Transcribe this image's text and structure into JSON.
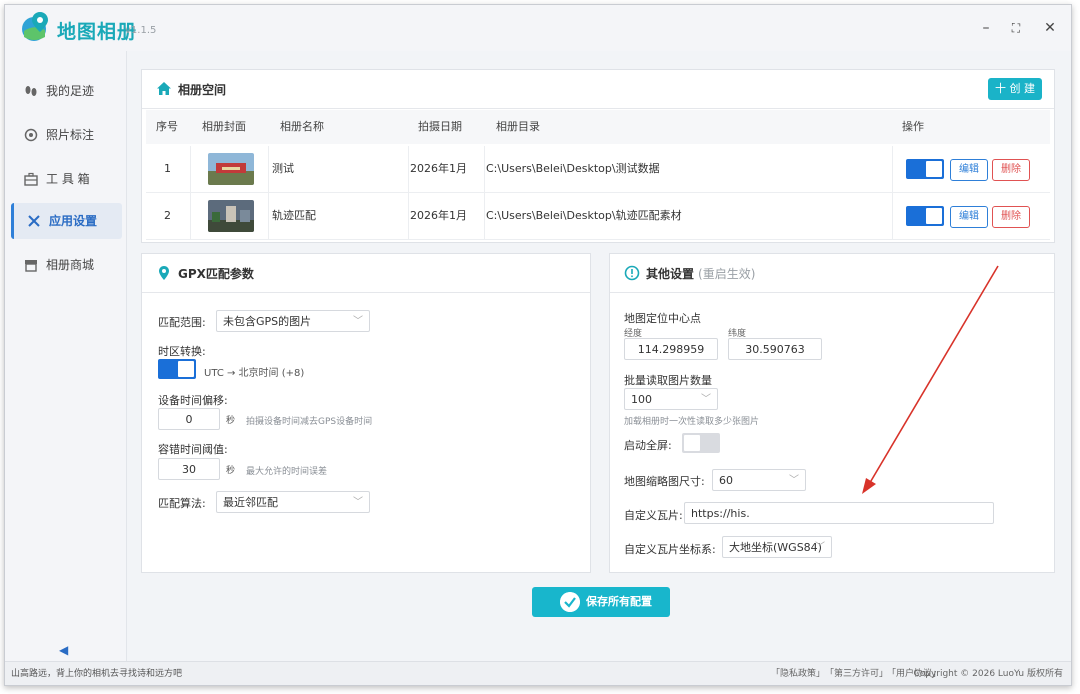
{
  "app": {
    "title": "地图相册",
    "version": "v1.1.5"
  },
  "window_controls": {
    "minimize": "–",
    "maximize": "⛶",
    "close": "✕"
  },
  "sidebar": {
    "items": [
      {
        "label": "我的足迹",
        "icon": "footprint-icon"
      },
      {
        "label": "照片标注",
        "icon": "target-icon"
      },
      {
        "label": "工 具 箱",
        "icon": "toolbox-icon"
      },
      {
        "label": "应用设置",
        "icon": "tools-icon",
        "active": true
      },
      {
        "label": "相册商城",
        "icon": "shop-icon"
      }
    ],
    "collapse": "◀"
  },
  "album_space": {
    "title": "相册空间",
    "create_label": "十 创 建",
    "columns": [
      "序号",
      "相册封面",
      "相册名称",
      "拍摄日期",
      "相册目录",
      "操作"
    ],
    "rows": [
      {
        "index": "1",
        "name": "测试",
        "date": "2026年1月",
        "path": "C:\\Users\\Belei\\Desktop\\测试数据",
        "enabled": true,
        "edit": "编辑",
        "delete": "删除"
      },
      {
        "index": "2",
        "name": "轨迹匹配",
        "date": "2026年1月",
        "path": "C:\\Users\\Belei\\Desktop\\轨迹匹配素材",
        "enabled": true,
        "edit": "编辑",
        "delete": "删除"
      }
    ]
  },
  "gpx": {
    "title": "GPX匹配参数",
    "range_label": "匹配范围:",
    "range_value": "未包含GPS的图片",
    "tz_label": "时区转换:",
    "tz_text": "UTC → 北京时间 (+8)",
    "tz_enabled": true,
    "offset_label": "设备时间偏移:",
    "offset_value": "0",
    "offset_unit": "秒",
    "offset_hint": "拍摄设备时间减去GPS设备时间",
    "tolerance_label": "容错时间阈值:",
    "tolerance_value": "30",
    "tolerance_unit": "秒",
    "tolerance_hint": "最大允许的时间误差",
    "algo_label": "匹配算法:",
    "algo_value": "最近邻匹配"
  },
  "other": {
    "title": "其他设置",
    "subtitle": "(重启生效)",
    "center_label": "地图定位中心点",
    "lng_label": "经度",
    "lng_value": "114.298959",
    "lat_label": "纬度",
    "lat_value": "30.590763",
    "batch_label": "批量读取图片数量",
    "batch_value": "100",
    "batch_hint": "加载相册时一次性读取多少张图片",
    "fullscreen_label": "启动全屏:",
    "fullscreen_enabled": false,
    "thumb_label": "地图缩略图尺寸:",
    "thumb_value": "60",
    "tile_label": "自定义瓦片:",
    "tile_value": "https://his.",
    "crs_label": "自定义瓦片坐标系:",
    "crs_value": "大地坐标(WGS84)"
  },
  "save_label": "保存所有配置",
  "status": {
    "slogan": "山高路远，背上你的相机去寻找诗和远方吧",
    "links": [
      "「隐私政策」",
      "「第三方许可」",
      "「用户协议」"
    ],
    "copyright": "Copyright © 2026 LuoYu 版权所有"
  },
  "colors": {
    "accent": "#1ab3c8",
    "primary": "#1a6fd8",
    "danger": "#e05252",
    "arrow": "#d8332a"
  }
}
